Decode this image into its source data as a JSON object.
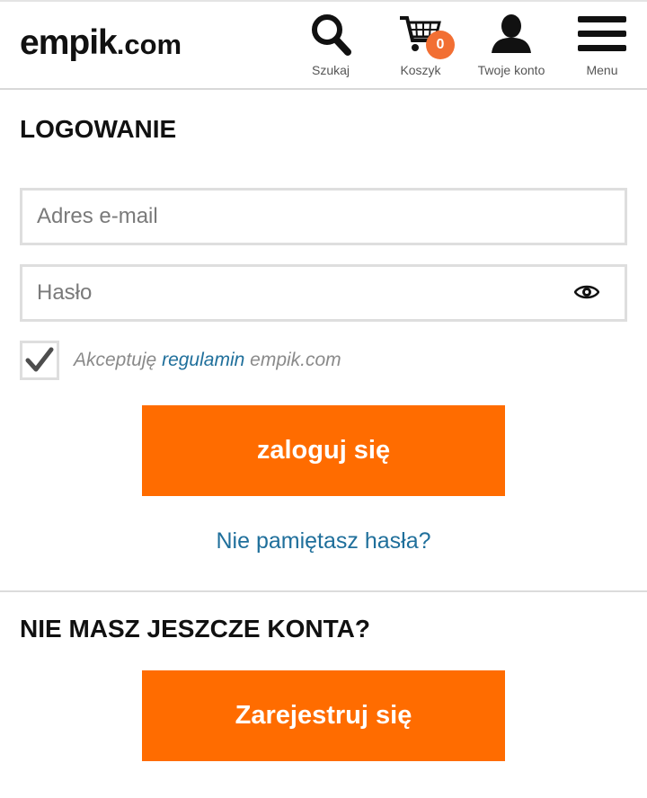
{
  "header": {
    "logo_main": "emp",
    "logo_accent": "ik",
    "logo_suffix": ".com",
    "nav": [
      {
        "label": "Szukaj",
        "icon": "search-icon"
      },
      {
        "label": "Koszyk",
        "icon": "cart-icon",
        "badge": "0"
      },
      {
        "label": "Twoje konto",
        "icon": "user-icon"
      },
      {
        "label": "Menu",
        "icon": "hamburger-icon"
      }
    ]
  },
  "login": {
    "title": "LOGOWANIE",
    "email_placeholder": "Adres e-mail",
    "password_placeholder": "Hasło",
    "terms_prefix": "Akceptuję",
    "terms_link": "regulamin",
    "terms_suffix": "empik.com",
    "terms_checked": true,
    "submit_label": "zaloguj się",
    "forgot_label": "Nie pamiętasz hasła?"
  },
  "register": {
    "title": "NIE MASZ JESZCZE KONTA?",
    "button_label": "Zarejestruj się"
  },
  "colors": {
    "accent": "#ff6c00",
    "badge": "#f26f33",
    "link": "#1f6f9b"
  }
}
